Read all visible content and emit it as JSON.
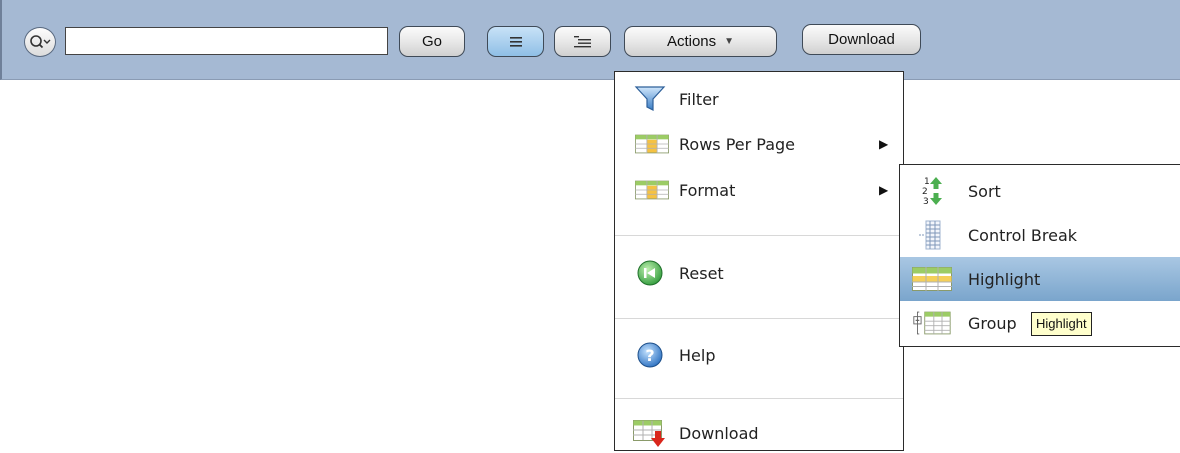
{
  "toolbar": {
    "search_value": "",
    "go_label": "Go",
    "actions_label": "Actions",
    "actions_caret": "▼",
    "download_label": "Download"
  },
  "actions_menu": {
    "items": [
      {
        "label": "Filter",
        "icon": "funnel-icon"
      },
      {
        "label": "Rows Per Page",
        "icon": "grid-icon",
        "arrow": "▶"
      },
      {
        "label": "Format",
        "icon": "grid-icon",
        "arrow": "▶"
      },
      {
        "label": "Reset",
        "icon": "reset-icon"
      },
      {
        "label": "Help",
        "icon": "help-icon"
      },
      {
        "label": "Download",
        "icon": "download-icon"
      }
    ]
  },
  "format_submenu": {
    "items": [
      {
        "label": "Sort",
        "icon": "sort-icon"
      },
      {
        "label": "Control Break",
        "icon": "control-break-icon"
      },
      {
        "label": "Highlight",
        "icon": "highlight-icon",
        "active": true
      },
      {
        "label": "Group",
        "icon": "group-icon"
      }
    ],
    "tooltip": "Highlight"
  },
  "colors": {
    "toolbar_bg": "#a5b9d3",
    "active_item": "#7aa5cc",
    "tooltip_bg": "#ffffcc"
  }
}
